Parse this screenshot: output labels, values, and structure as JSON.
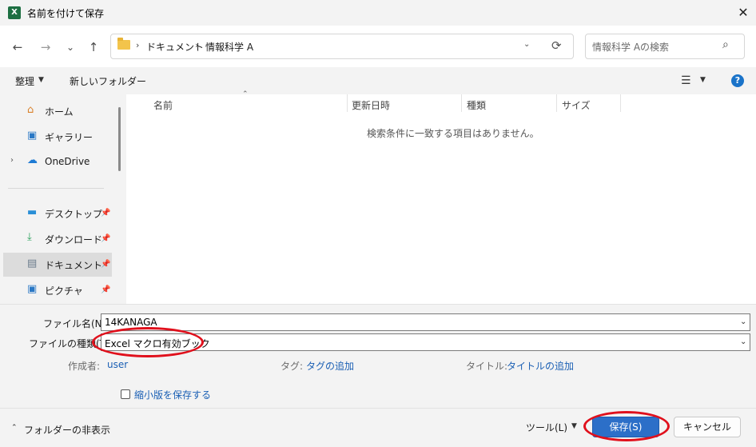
{
  "window": {
    "title": "名前を付けて保存",
    "app_icon_letter": "X",
    "close": "✕"
  },
  "nav": {
    "back": "←",
    "forward": "→",
    "history": "⌄",
    "up": "↑",
    "breadcrumb": [
      "ドキュメント",
      "情報科学 A"
    ],
    "refresh": "⟳",
    "search_placeholder": "情報科学 Aの検索"
  },
  "toolbar": {
    "organize": "整理",
    "new_folder": "新しいフォルダー",
    "help": "?"
  },
  "sidebar": {
    "items": [
      {
        "label": "ホーム"
      },
      {
        "label": "ギャラリー"
      },
      {
        "label": "OneDrive"
      },
      {
        "label": "デスクトップ"
      },
      {
        "label": "ダウンロード"
      },
      {
        "label": "ドキュメント"
      },
      {
        "label": "ピクチャ"
      }
    ]
  },
  "filelist": {
    "columns": [
      "名前",
      "更新日時",
      "種類",
      "サイズ"
    ],
    "empty_message": "検索条件に一致する項目はありません。"
  },
  "form": {
    "filename_label": "ファイル名(N):",
    "filename_value": "14KANAGA",
    "filetype_label": "ファイルの種類(T):",
    "filetype_value": "Excel マクロ有効ブック",
    "author_label": "作成者:",
    "author_value": "user",
    "tags_label": "タグ:",
    "tags_value": "タグの追加",
    "title_label": "タイトル:",
    "title_value": "タイトルの追加",
    "thumbnail_label": "縮小版を保存する"
  },
  "footer": {
    "hide_folders": "フォルダーの非表示",
    "tools": "ツール(L)",
    "save": "保存(S)",
    "cancel": "キャンセル"
  },
  "colors": {
    "accent": "#2c6fc8",
    "annotation": "#e0101c",
    "excel": "#1d6f42"
  }
}
